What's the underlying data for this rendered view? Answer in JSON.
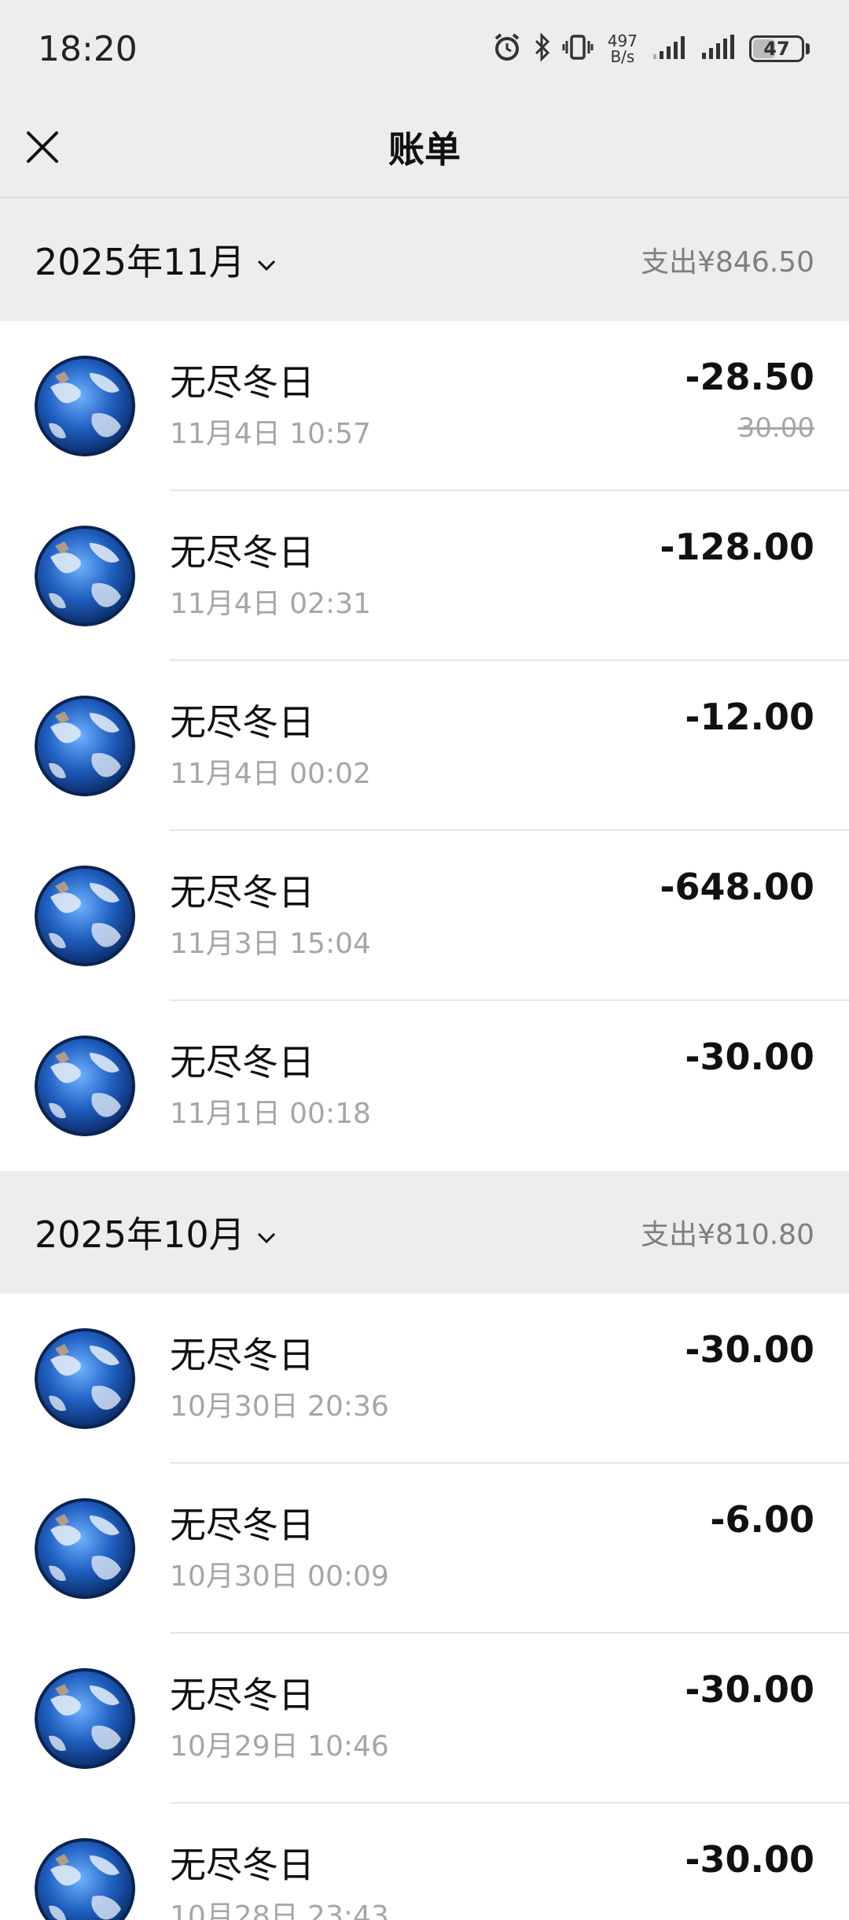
{
  "status_bar": {
    "time": "18:20",
    "net_speed_value": "497",
    "net_speed_unit": "B/s",
    "battery": "47",
    "battery_level_percent": 47,
    "icons": [
      "alarm-icon",
      "bluetooth-icon",
      "vibrate-icon",
      "signal-icon",
      "signal-icon",
      "battery-icon"
    ]
  },
  "nav": {
    "title": "账单",
    "close_icon": "close-icon"
  },
  "sections": [
    {
      "month_label": "2025年11月",
      "total_label": "支出",
      "total_amount": "¥846.50",
      "items": [
        {
          "merchant": "无尽冬日",
          "time": "11月4日 10:57",
          "amount": "-28.50",
          "original": "30.00"
        },
        {
          "merchant": "无尽冬日",
          "time": "11月4日 02:31",
          "amount": "-128.00"
        },
        {
          "merchant": "无尽冬日",
          "time": "11月4日 00:02",
          "amount": "-12.00"
        },
        {
          "merchant": "无尽冬日",
          "time": "11月3日 15:04",
          "amount": "-648.00"
        },
        {
          "merchant": "无尽冬日",
          "time": "11月1日 00:18",
          "amount": "-30.00"
        }
      ]
    },
    {
      "month_label": "2025年10月",
      "total_label": "支出",
      "total_amount": "¥810.80",
      "items": [
        {
          "merchant": "无尽冬日",
          "time": "10月30日 20:36",
          "amount": "-30.00"
        },
        {
          "merchant": "无尽冬日",
          "time": "10月30日 00:09",
          "amount": "-6.00"
        },
        {
          "merchant": "无尽冬日",
          "time": "10月29日 10:46",
          "amount": "-30.00"
        },
        {
          "merchant": "无尽冬日",
          "time": "10月28日 23:43",
          "amount": "-30.00"
        }
      ]
    }
  ],
  "colors": {
    "background": "#ededed",
    "list_background": "#ffffff",
    "primary_text": "#111111",
    "secondary_text": "#a6a6a6",
    "avatar_globe": "#1f5fc0"
  }
}
